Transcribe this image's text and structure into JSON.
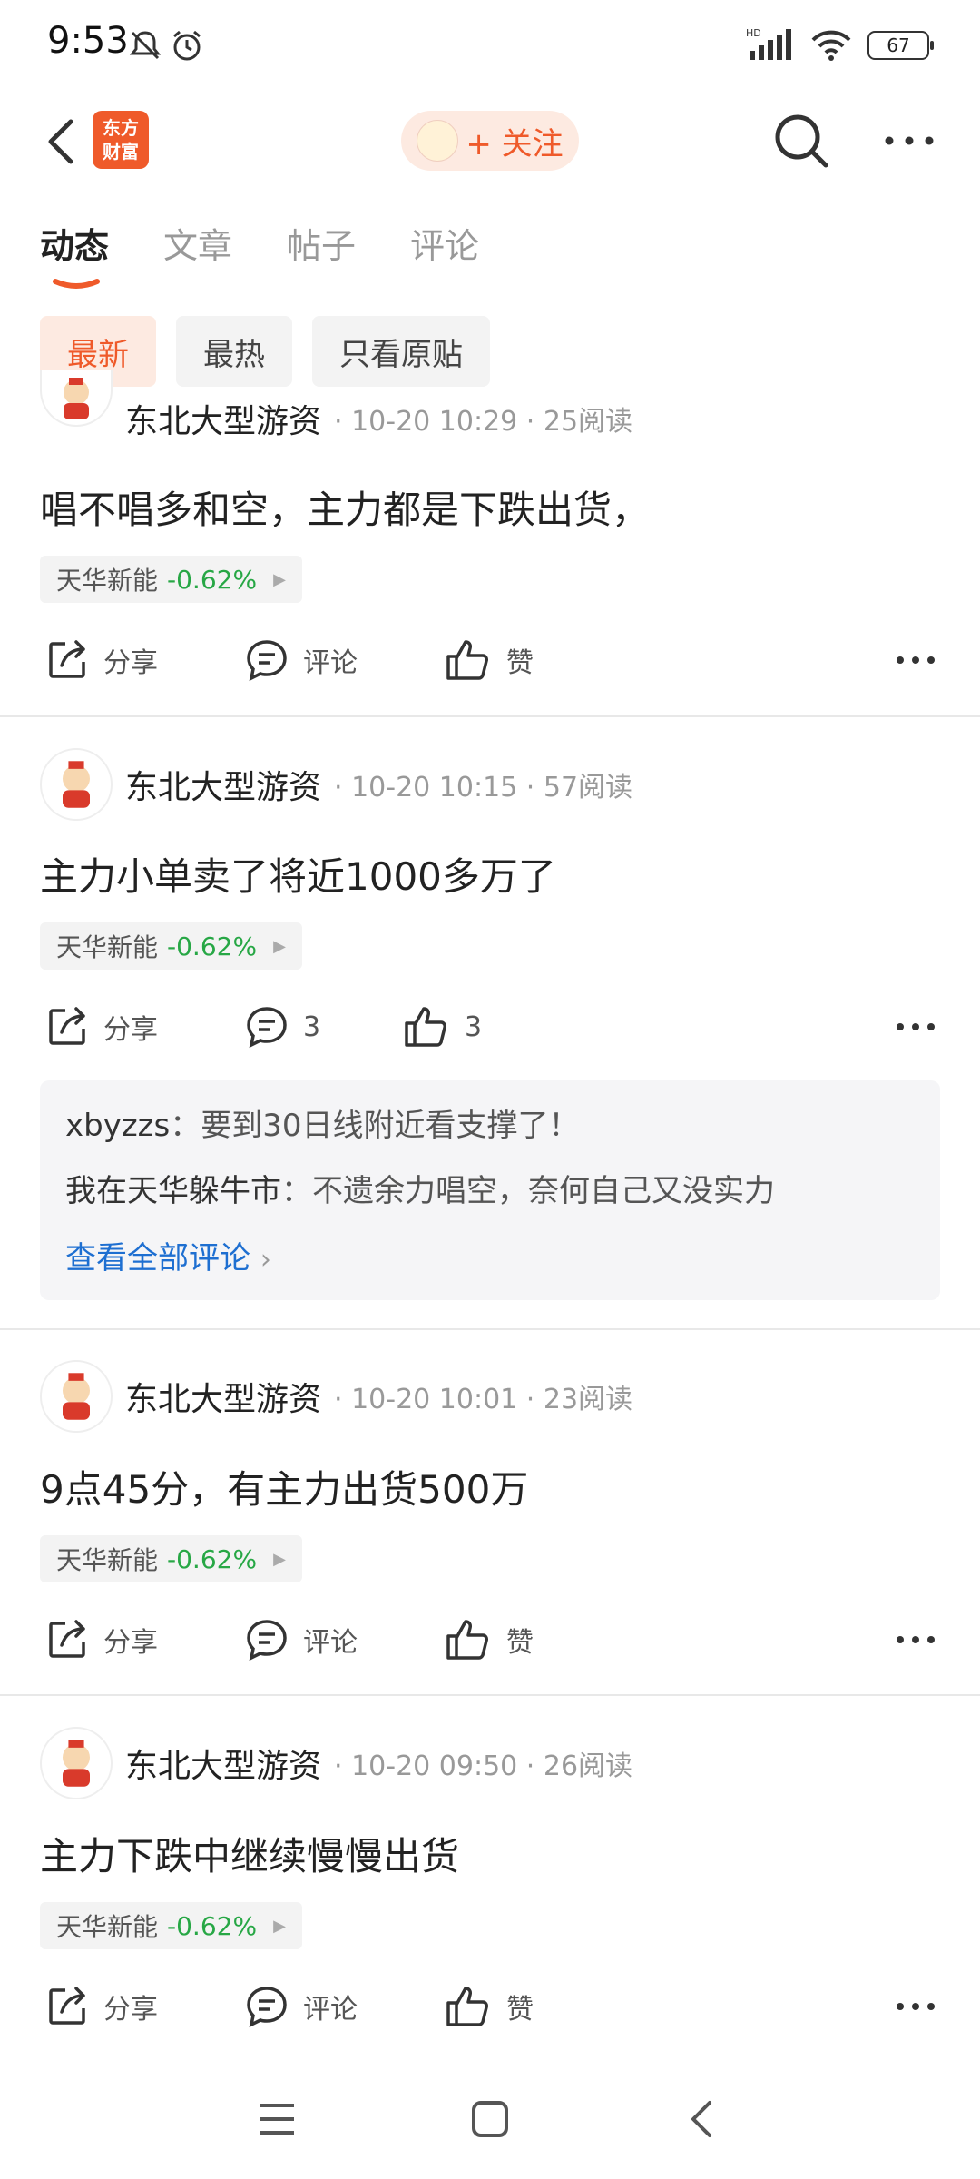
{
  "status_bar": {
    "time": "9:53",
    "hd_label": "HD",
    "battery": "67"
  },
  "header": {
    "logo_text_1": "东方",
    "logo_text_2": "财富",
    "follow_label": "+ 关注"
  },
  "tabs": [
    {
      "label": "动态",
      "active": true
    },
    {
      "label": "文章",
      "active": false
    },
    {
      "label": "帖子",
      "active": false
    },
    {
      "label": "评论",
      "active": false
    }
  ],
  "filters": [
    {
      "label": "最新",
      "active": true
    },
    {
      "label": "最热",
      "active": false
    },
    {
      "label": "只看原贴",
      "active": false
    }
  ],
  "posts": [
    {
      "author": "东北大型游资",
      "meta": "· 10-20 10:29 · 25阅读",
      "text": "唱不唱多和空，主力都是下跌出货，",
      "stock_name": "天华新能",
      "stock_change": "-0.62%",
      "share_label": "分享",
      "comment_label": "评论",
      "like_label": "赞"
    },
    {
      "author": "东北大型游资",
      "meta": "· 10-20 10:15 · 57阅读",
      "text": "主力小单卖了将近1000多万了",
      "stock_name": "天华新能",
      "stock_change": "-0.62%",
      "share_label": "分享",
      "comment_label": "3",
      "like_label": "3",
      "comments": [
        {
          "user": "xbyzzs",
          "text": "：要到30日线附近看支撑了！"
        },
        {
          "user": "我在天华躲牛市",
          "text": "：不遗余力唱空，奈何自己又没实力"
        }
      ],
      "view_all_label": "查看全部评论"
    },
    {
      "author": "东北大型游资",
      "meta": "· 10-20 10:01 · 23阅读",
      "text": "9点45分，有主力出货500万",
      "stock_name": "天华新能",
      "stock_change": "-0.62%",
      "share_label": "分享",
      "comment_label": "评论",
      "like_label": "赞"
    },
    {
      "author": "东北大型游资",
      "meta": "· 10-20 09:50 · 26阅读",
      "text": "主力下跌中继续慢慢出货",
      "stock_name": "天华新能",
      "stock_change": "-0.62%",
      "share_label": "分享",
      "comment_label": "评论",
      "like_label": "赞"
    }
  ],
  "colors": {
    "accent": "#ef5a2a",
    "down": "#27a745",
    "link": "#1e6fd1"
  }
}
